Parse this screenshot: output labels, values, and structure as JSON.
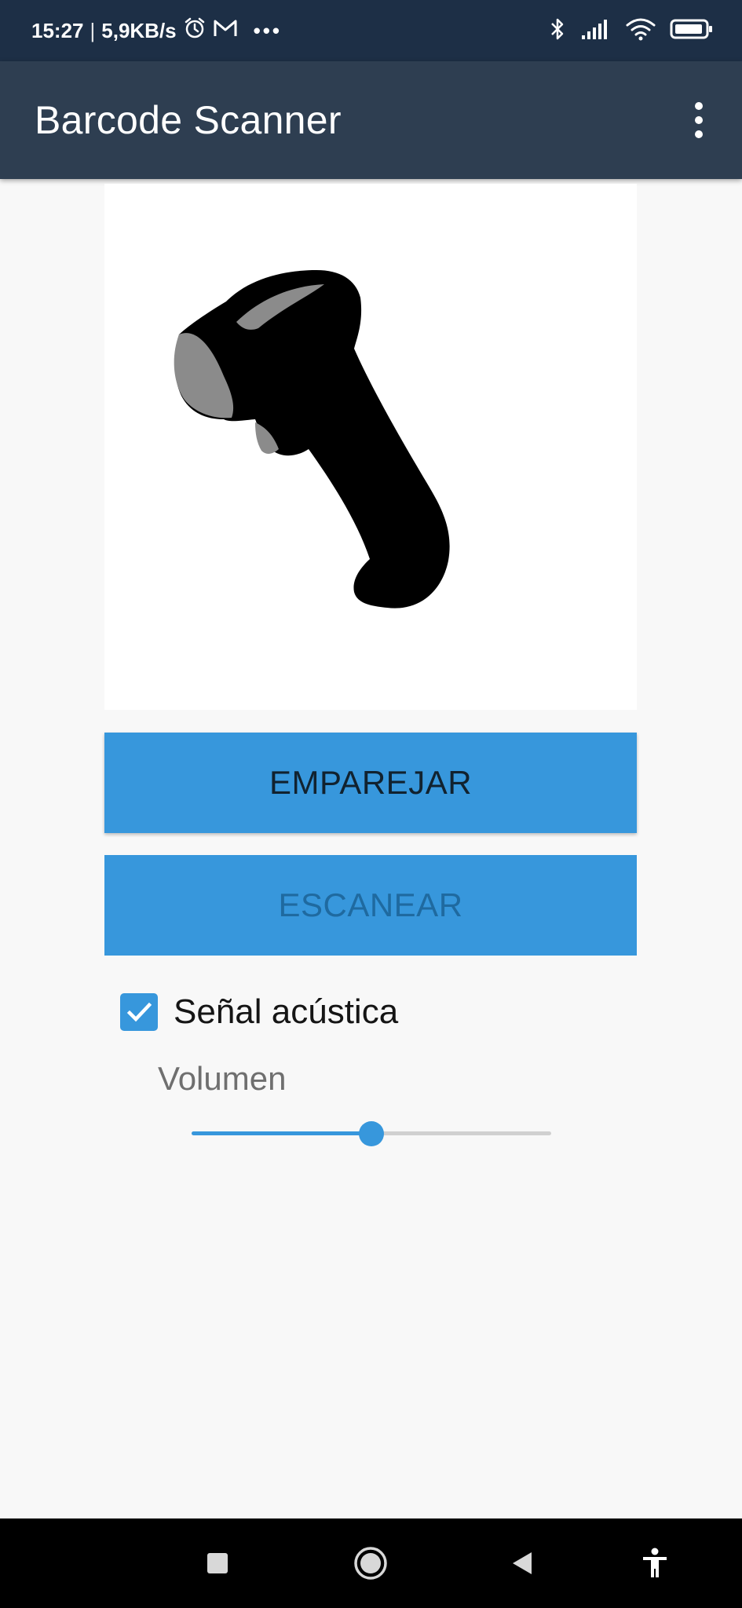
{
  "status_bar": {
    "time": "15:27",
    "separator": "|",
    "network_speed": "5,9KB/s",
    "notification_more": "•••",
    "icons": [
      "alarm-icon",
      "gmail-icon",
      "more-notifications-icon",
      "bluetooth-icon",
      "signal-icon",
      "wifi-icon",
      "battery-icon"
    ]
  },
  "app_bar": {
    "title": "Barcode Scanner",
    "menu_icon": "more-vert-icon"
  },
  "scanner_image": {
    "description_icon": "barcode-scanner-icon"
  },
  "buttons": {
    "pair_label": "EMPAREJAR",
    "scan_label": "ESCANEAR",
    "scan_enabled": false
  },
  "beep": {
    "label": "Señal acústica",
    "checked": true
  },
  "volume": {
    "label": "Volumen",
    "level_fraction": 0.5
  },
  "nav_bar": {
    "icons": [
      "recents-icon",
      "home-icon",
      "back-icon",
      "accessibility-icon"
    ]
  },
  "colors": {
    "status_bar": "#1d2f46",
    "app_bar": "#2e3e51",
    "accent": "#3797dc",
    "background": "#f8f8f8"
  }
}
